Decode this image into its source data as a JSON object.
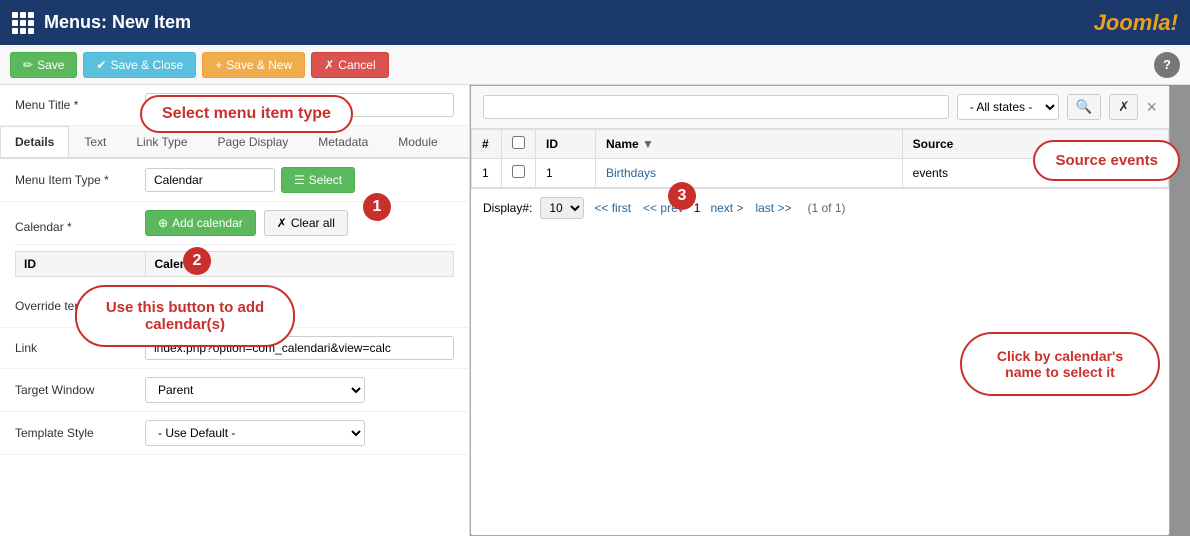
{
  "topbar": {
    "title": "Menus: New Item",
    "joomla_label": "Joomla!"
  },
  "toolbar": {
    "save_label": "Save",
    "save_close_label": "Save & Close",
    "save_new_label": "Save & New",
    "cancel_label": "Cancel",
    "help_label": "?"
  },
  "form": {
    "menu_title_label": "Menu Title *",
    "menu_title_value": "",
    "menu_item_type_label": "Menu Item Type *",
    "menu_item_type_value": "Calendar",
    "calendar_label": "Calendar *",
    "override_template_label": "Override template",
    "link_label": "Link",
    "link_value": "index.php?option=com_calendari&view=calc",
    "target_window_label": "Target Window",
    "target_window_value": "Parent",
    "template_style_label": "Template Style",
    "template_style_value": "- Use Default -"
  },
  "tabs": [
    {
      "label": "Details",
      "active": true
    },
    {
      "label": "Text"
    },
    {
      "label": "Link Type"
    },
    {
      "label": "Page Display"
    },
    {
      "label": "Metadata"
    },
    {
      "label": "Module"
    }
  ],
  "calendar_table": {
    "headers": [
      "ID",
      "Calendar"
    ],
    "rows": []
  },
  "buttons": {
    "add_calendar": "Add calendar",
    "clear_all": "Clear all",
    "select": "Select"
  },
  "callouts": {
    "select_menu_item_type": "Select menu item type",
    "use_button_to_add": "Use this button to add calendar(s)",
    "click_by_calendar_name": "Click by calendar's name to select it",
    "source_events": "Source events"
  },
  "steps": {
    "step1": "1",
    "step2": "2",
    "step3": "3"
  },
  "modal": {
    "search_placeholder": "",
    "all_states_label": "- All states -",
    "close_label": "×",
    "table": {
      "headers": [
        "#",
        "",
        "ID",
        "Name",
        "Source"
      ],
      "rows": [
        {
          "num": "1",
          "id": "1",
          "name": "Birthdays",
          "source": "events"
        }
      ]
    },
    "pagination": {
      "display_label": "Display#:",
      "display_value": "10",
      "first_label": "<< first",
      "prev_label": "<< prev",
      "current_page": "1",
      "next_label": "next >",
      "last_label": "last >>",
      "page_info": "(1 of 1)"
    }
  }
}
